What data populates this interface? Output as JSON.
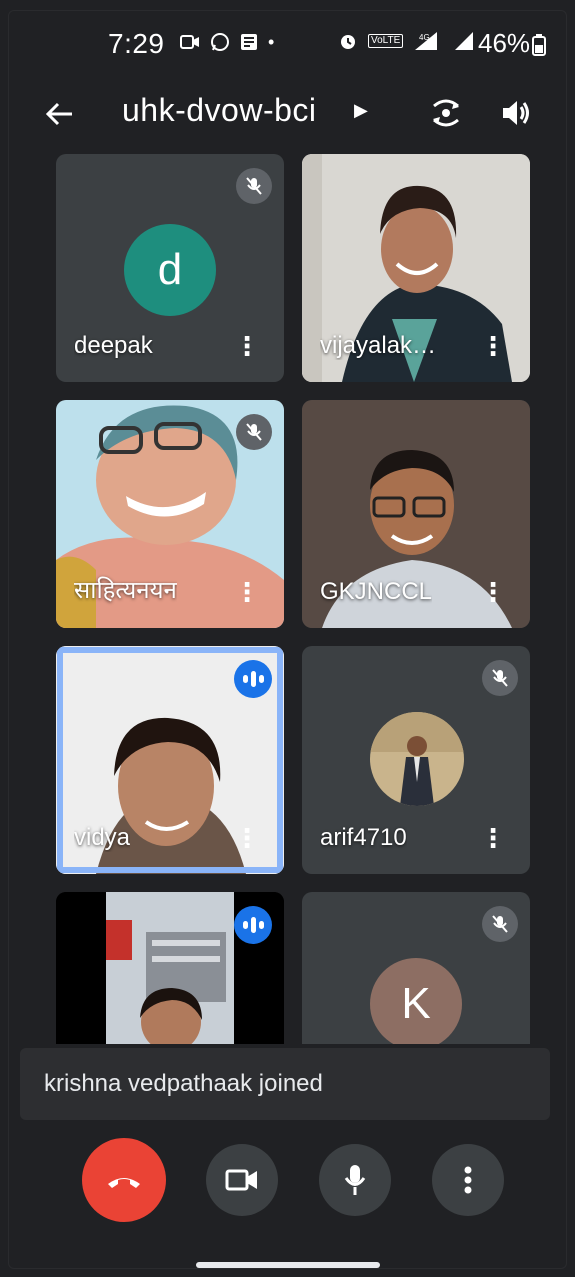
{
  "status_bar": {
    "time": "7:29",
    "battery_percent": "46%",
    "network_badge_1": "VoLTE",
    "network_badge_2": "4G"
  },
  "header": {
    "meeting_code": "uhk-dvow-bci",
    "icons": [
      "back-arrow-icon",
      "caret-right-icon",
      "switch-camera-icon",
      "speaker-icon"
    ]
  },
  "participants": [
    {
      "name": "deepak",
      "initial": "d",
      "avatar_color": "#1e8e7e",
      "muted": true
    },
    {
      "name": "vijayalak…",
      "muted": false
    },
    {
      "name": "साहित्यनयन",
      "muted": true
    },
    {
      "name": "GKJNCCL",
      "muted": false
    },
    {
      "name": "vidya",
      "speaking": true
    },
    {
      "name": "arif4710",
      "muted": true
    },
    {
      "name": "",
      "speaking": true
    },
    {
      "name": "",
      "initial": "K",
      "avatar_color": "#8d6e63",
      "muted": true
    }
  ],
  "toast": {
    "message": "krishna vedpathaak joined"
  },
  "controls": [
    "end-call-button",
    "camera-button",
    "microphone-button",
    "more-options-button"
  ],
  "colors": {
    "end_call": "#ea4335",
    "speaking": "#1a73e8",
    "active_border": "#8ab4f8",
    "tile_bg": "#3c4043"
  }
}
